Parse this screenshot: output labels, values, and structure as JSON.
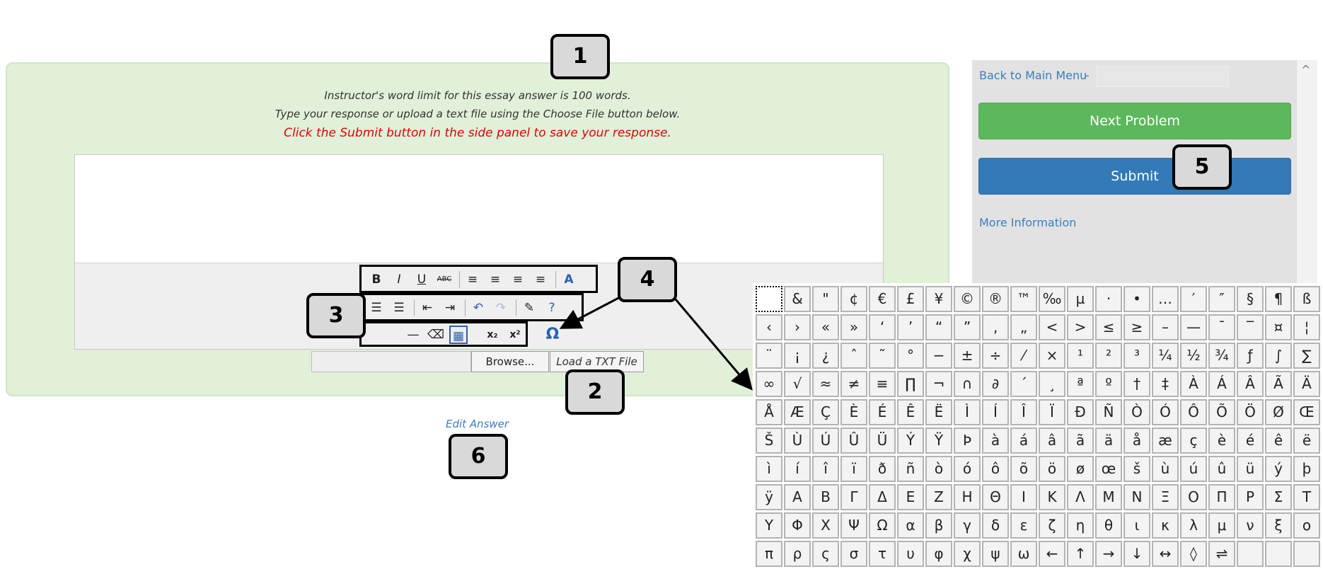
{
  "essay": {
    "instruction_1": "Instructor's word limit for this essay answer is 100 words.",
    "instruction_2": "Type your response or upload a text file using the Choose File button below.",
    "instruction_3": "Click the Submit button in the side panel to save your response.",
    "browse_label": "Browse...",
    "load_txt_label": "Load a TXT File",
    "edit_answer_label": "Edit Answer"
  },
  "toolbar": {
    "row1": [
      {
        "name": "bold-icon",
        "glyph": "B"
      },
      {
        "name": "italic-icon",
        "glyph": "I"
      },
      {
        "name": "underline-icon",
        "glyph": "U"
      },
      {
        "name": "strikethrough-icon",
        "glyph": "ABC"
      },
      {
        "name": "align-left-icon",
        "glyph": "≡"
      },
      {
        "name": "align-center-icon",
        "glyph": "≡"
      },
      {
        "name": "align-right-icon",
        "glyph": "≡"
      },
      {
        "name": "align-justify-icon",
        "glyph": "≡"
      },
      {
        "name": "font-color-icon",
        "glyph": "A"
      }
    ],
    "row2": [
      {
        "name": "bullet-list-icon",
        "glyph": "☰"
      },
      {
        "name": "numbered-list-icon",
        "glyph": "☰"
      },
      {
        "name": "outdent-icon",
        "glyph": "⇤"
      },
      {
        "name": "indent-icon",
        "glyph": "⇥"
      },
      {
        "name": "undo-icon",
        "glyph": "↶"
      },
      {
        "name": "redo-icon",
        "glyph": "↷"
      },
      {
        "name": "cleanup-icon",
        "glyph": "✎"
      },
      {
        "name": "help-icon",
        "glyph": "?"
      }
    ],
    "row3": [
      {
        "name": "horizontal-rule-icon",
        "glyph": "—"
      },
      {
        "name": "eraser-icon",
        "glyph": "⌫"
      },
      {
        "name": "table-icon",
        "glyph": "▦"
      },
      {
        "name": "subscript-icon",
        "glyph": "x₂"
      },
      {
        "name": "superscript-icon",
        "glyph": "x²"
      },
      {
        "name": "special-characters-icon",
        "glyph": "Ω"
      }
    ]
  },
  "side_panel": {
    "back_main_label": "Back to Main Menu",
    "back_dash": "-",
    "next_problem_label": "Next Problem",
    "submit_label": "Submit",
    "more_info_label": "More Information",
    "scroll_up_glyph": "^"
  },
  "callouts": [
    "1",
    "2",
    "3",
    "4",
    "5",
    "6"
  ],
  "special_characters": [
    [
      "",
      "&",
      "\"",
      "¢",
      "€",
      "£",
      "¥",
      "©",
      "®",
      "™",
      "‰",
      "µ",
      "·",
      "•",
      "…",
      "′",
      "″",
      "§",
      "¶",
      "ß"
    ],
    [
      "‹",
      "›",
      "«",
      "»",
      "‘",
      "’",
      "“",
      "”",
      "‚",
      "„",
      "<",
      ">",
      "≤",
      "≥",
      "–",
      "—",
      "¯",
      "‾",
      "¤",
      "¦"
    ],
    [
      "¨",
      "¡",
      "¿",
      "ˆ",
      "˜",
      "°",
      "−",
      "±",
      "÷",
      "⁄",
      "×",
      "¹",
      "²",
      "³",
      "¼",
      "½",
      "¾",
      "ƒ",
      "∫",
      "∑"
    ],
    [
      "∞",
      "√",
      "≈",
      "≠",
      "≡",
      "∏",
      "¬",
      "∩",
      "∂",
      "´",
      "¸",
      "ª",
      "º",
      "†",
      "‡",
      "À",
      "Á",
      "Â",
      "Ã",
      "Ä"
    ],
    [
      "Å",
      "Æ",
      "Ç",
      "È",
      "É",
      "Ê",
      "Ë",
      "Ì",
      "Í",
      "Î",
      "Ï",
      "Ð",
      "Ñ",
      "Ò",
      "Ó",
      "Ô",
      "Õ",
      "Ö",
      "Ø",
      "Œ"
    ],
    [
      "Š",
      "Ù",
      "Ú",
      "Û",
      "Ü",
      "Ý",
      "Ÿ",
      "Þ",
      "à",
      "á",
      "â",
      "ã",
      "ä",
      "å",
      "æ",
      "ç",
      "è",
      "é",
      "ê",
      "ë"
    ],
    [
      "ì",
      "í",
      "î",
      "ï",
      "ð",
      "ñ",
      "ò",
      "ó",
      "ô",
      "õ",
      "ö",
      "ø",
      "œ",
      "š",
      "ù",
      "ú",
      "û",
      "ü",
      "ý",
      "þ"
    ],
    [
      "ÿ",
      "Α",
      "Β",
      "Γ",
      "Δ",
      "Ε",
      "Ζ",
      "Η",
      "Θ",
      "Ι",
      "Κ",
      "Λ",
      "Μ",
      "Ν",
      "Ξ",
      "Ο",
      "Π",
      "Ρ",
      "Σ",
      "Τ"
    ],
    [
      "Υ",
      "Φ",
      "Χ",
      "Ψ",
      "Ω",
      "α",
      "β",
      "γ",
      "δ",
      "ε",
      "ζ",
      "η",
      "θ",
      "ι",
      "κ",
      "λ",
      "μ",
      "ν",
      "ξ",
      "ο"
    ],
    [
      "π",
      "ρ",
      "ς",
      "σ",
      "τ",
      "υ",
      "φ",
      "χ",
      "ψ",
      "ω",
      "←",
      "↑",
      "→",
      "↓",
      "↔",
      "◊",
      "⇌",
      "",
      "",
      ""
    ]
  ],
  "colors": {
    "panel_green": "#e1f0d9",
    "warning_red": "#e60000",
    "link_blue": "#3a7fc1",
    "next_green": "#5cb85c",
    "submit_blue": "#337ab7"
  }
}
